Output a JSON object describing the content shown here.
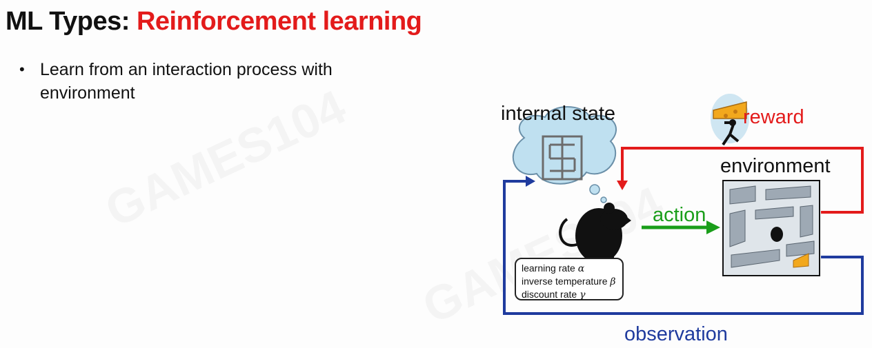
{
  "slide": {
    "title_prefix": "ML Types: ",
    "title_highlight": "Reinforcement learning",
    "bullet": "Learn from an interaction process with environment",
    "bullet_marker": "•"
  },
  "diagram": {
    "internal_state_label": "internal state",
    "reward_label": "reward",
    "environment_label": "environment",
    "action_label": "action",
    "observation_label": "observation",
    "params": [
      {
        "text": "learning rate ",
        "symbol": "α"
      },
      {
        "text": "inverse temperature ",
        "symbol": "β"
      },
      {
        "text": "discount rate ",
        "symbol": "γ"
      }
    ]
  },
  "watermark": "GAMES104",
  "colors": {
    "title_highlight": "#e31b1b",
    "reward": "#e31b1b",
    "action": "#1a9e1a",
    "observation": "#1f3b9e"
  }
}
